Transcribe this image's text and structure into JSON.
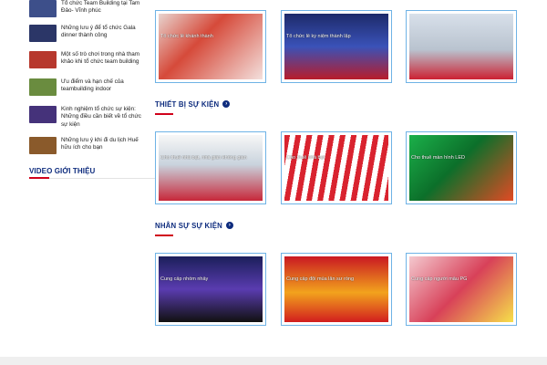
{
  "sidebar": {
    "posts": [
      {
        "title": "Tổ chức Team Building tại Tam Đảo- Vĩnh phúc",
        "thumb_color": "#3d4f8a"
      },
      {
        "title": "Những lưu ý để tổ chức Gala dinner thành công",
        "thumb_color": "#2b3667"
      },
      {
        "title": "Một số trò chơi trong nhà tham khảo khi tổ chức team building",
        "thumb_color": "#b7382d"
      },
      {
        "title": "Ưu điểm và hạn chế của teambuilding indoor",
        "thumb_color": "#6a8c3f"
      },
      {
        "title": "Kinh nghiệm tổ chức sự kiện: Những điều cần biết về tổ chức sự kiện",
        "thumb_color": "#45327a"
      },
      {
        "title": "Những lưu ý khi đi du lịch Huế hữu ích cho bạn",
        "thumb_color": "#8a5a2b"
      }
    ],
    "video_heading": "VIDEO GIỚI THIỆU"
  },
  "sections": {
    "top": {
      "cards": [
        {
          "caption": "Tổ chức lễ khánh thành"
        },
        {
          "caption": "Tổ chức lễ kỷ niệm thành lập"
        },
        {
          "caption": ""
        }
      ]
    },
    "equipment": {
      "title": "THIẾT BỊ SỰ KIỆN",
      "arrow": "›",
      "cards": [
        {
          "caption": "Cho thuê nhà bạt, nhà giàn không gian"
        },
        {
          "caption": "Cho thuê nhà bạt"
        },
        {
          "caption": "Cho thuê màn hình LED"
        }
      ]
    },
    "staff": {
      "title": "NHÂN SỰ SỰ KIỆN",
      "arrow": "›",
      "cards": [
        {
          "caption": "Cung cấp nhóm nhảy"
        },
        {
          "caption": "Cung cấp đội múa lân sư rồng"
        },
        {
          "caption": "Cung cấp người mẫu PG"
        }
      ]
    }
  },
  "colors": {
    "heading": "#0e2c7e",
    "accent": "#d0021b",
    "card_border": "#6fb3e6"
  }
}
